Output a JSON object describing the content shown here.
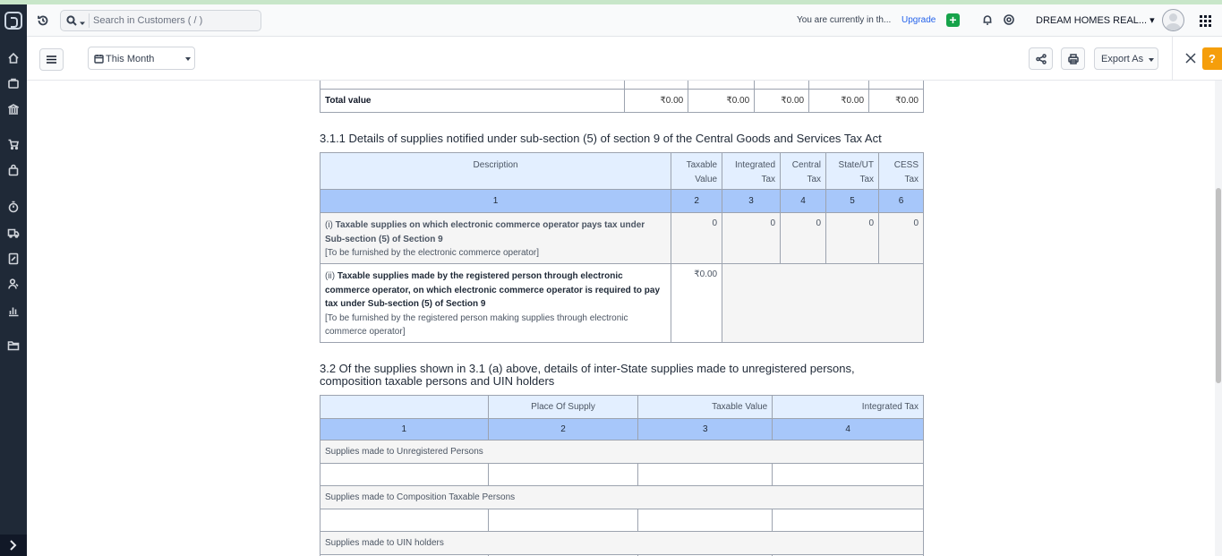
{
  "header": {
    "search_placeholder": "Search in Customers ( / )",
    "org_notice": "You are currently in th...",
    "upgrade_label": "Upgrade",
    "plus_label": "+",
    "org_name": "DREAM HOMES REAL... ▾"
  },
  "toolbar": {
    "period": "This Month",
    "export_label": "Export As",
    "help_label": "?"
  },
  "table_total": {
    "label": "Total value",
    "values": [
      "₹0.00",
      "₹0.00",
      "₹0.00",
      "₹0.00",
      "₹0.00"
    ]
  },
  "section_311": {
    "title": "3.1.1 Details of supplies notified under sub-section (5) of section 9 of the Central Goods and Services Tax Act",
    "columns": [
      {
        "line1": "Description",
        "line2": ""
      },
      {
        "line1": "Taxable",
        "line2": "Value"
      },
      {
        "line1": "Integrated",
        "line2": "Tax"
      },
      {
        "line1": "Central",
        "line2": "Tax"
      },
      {
        "line1": "State/UT",
        "line2": "Tax"
      },
      {
        "line1": "CESS",
        "line2": "Tax"
      }
    ],
    "numbers": [
      "1",
      "2",
      "3",
      "4",
      "5",
      "6"
    ],
    "row1": {
      "prefix": "(i) ",
      "bold": "Taxable supplies on which electronic commerce operator pays tax under Sub-section (5) of Section 9",
      "note": "[To be furnished by the electronic commerce operator]",
      "values": [
        "0",
        "0",
        "0",
        "0",
        "0"
      ]
    },
    "row2": {
      "prefix": "(ii) ",
      "bold": "Taxable supplies made by the registered person through electronic commerce operator, on which electronic commerce operator is required to pay tax under Sub-section (5) of Section 9",
      "note": "[To be furnished by the registered person making supplies through electronic commerce operator]",
      "value": "₹0.00"
    }
  },
  "section_32": {
    "title_line1": "3.2 Of the supplies shown in 3.1 (a) above, details of inter-State supplies made to unregistered persons,",
    "title_line2": "composition taxable persons and UIN holders",
    "columns": [
      "",
      "Place Of Supply",
      "Taxable Value",
      "Integrated Tax"
    ],
    "numbers": [
      "1",
      "2",
      "3",
      "4"
    ],
    "groups": [
      "Supplies made to Unregistered Persons",
      "Supplies made to Composition Taxable Persons",
      "Supplies made to UIN holders"
    ]
  }
}
